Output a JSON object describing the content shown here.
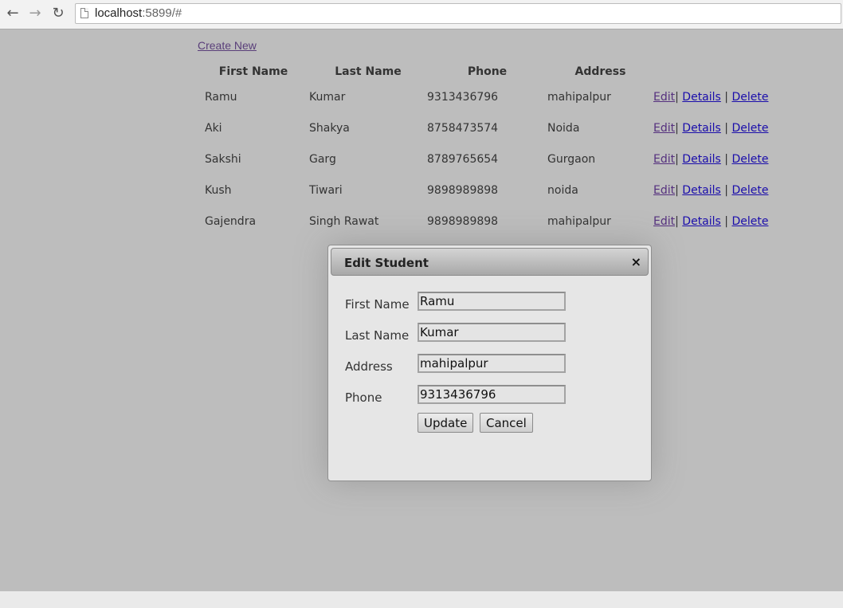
{
  "browser": {
    "url_host": "localhost",
    "url_rest": ":5899/#",
    "back_icon": "arrow-left",
    "forward_icon": "arrow-right",
    "reload_icon": "reload"
  },
  "page": {
    "create_new": "Create New",
    "columns": [
      "First Name",
      "Last Name",
      "Phone",
      "Address"
    ],
    "rows": [
      {
        "first": "Ramu",
        "last": "Kumar",
        "phone": "9313436796",
        "address": "mahipalpur"
      },
      {
        "first": "Aki",
        "last": "Shakya",
        "phone": "8758473574",
        "address": "Noida"
      },
      {
        "first": "Sakshi",
        "last": "Garg",
        "phone": "8789765654",
        "address": "Gurgaon"
      },
      {
        "first": "Kush",
        "last": "Tiwari",
        "phone": "9898989898",
        "address": "noida"
      },
      {
        "first": "Gajendra",
        "last": "Singh Rawat",
        "phone": "9898989898",
        "address": "mahipalpur"
      }
    ],
    "actions": {
      "edit": "Edit",
      "details": "Details",
      "delete": "Delete",
      "sep": "|"
    }
  },
  "dialog": {
    "title": "Edit Student",
    "close": "×",
    "fields": [
      {
        "label": "First Name",
        "value": "Ramu"
      },
      {
        "label": "Last Name",
        "value": "Kumar"
      },
      {
        "label": "Address",
        "value": "mahipalpur"
      },
      {
        "label": "Phone",
        "value": "9313436796"
      }
    ],
    "update": "Update",
    "cancel": "Cancel"
  }
}
